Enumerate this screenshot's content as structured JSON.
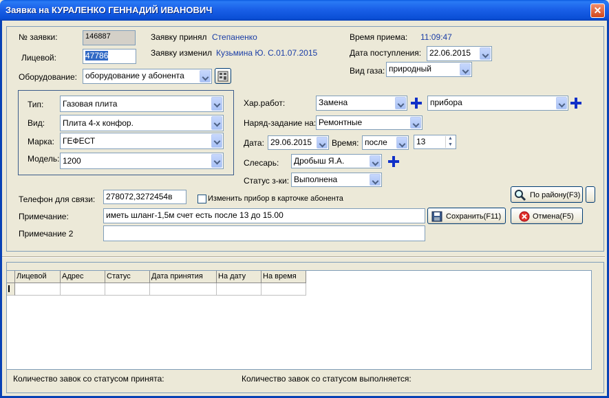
{
  "window": {
    "title": "Заявка на КУРАЛЕНКО ГЕННАДИЙ ИВАНОВИЧ",
    "close_icon": "close-icon"
  },
  "header": {
    "order_no_label": "№ заявки:",
    "order_no_value": "146887",
    "account_label": "Лицевой:",
    "account_value": "47786",
    "equipment_label": "Оборудование:",
    "equipment_value": "оборудование у абонента",
    "accepted_by_label": "Заявку принял",
    "accepted_by_value": "Степаненко",
    "changed_by_label": "Заявку изменил",
    "changed_by_value": "Кузьмина Ю. С.01.07.2015",
    "reception_time_label": "Время приема:",
    "reception_time_value": "11:09:47",
    "arrival_date_label": "Дата поступления:",
    "arrival_date_value": "22.06.2015",
    "gas_type_label": "Вид газа:",
    "gas_type_value": "природный"
  },
  "device": {
    "type_label": "Тип:",
    "type_value": "Газовая плита",
    "kind_label": "Вид:",
    "kind_value": "Плита 4-х конфор.",
    "brand_label": "Марка:",
    "brand_value": "ГЕФЕСТ",
    "model_label": "Модель:",
    "model_value": "1200"
  },
  "work": {
    "work_char_label": "Хар.работ:",
    "work_char_value": "Замена",
    "work_object_value": "прибора",
    "task_label": "Наряд-задание на:",
    "task_value": "Ремонтные",
    "date_label": "Дата:",
    "date_value": "29.06.2015",
    "time_label": "Время:",
    "time_value": "после",
    "time_hour": "13",
    "fitter_label": "Слесарь:",
    "fitter_value": "Дробыш Я.А.",
    "status_label": "Статус з-ки:",
    "status_value": "Выполнена"
  },
  "contact": {
    "phone_label": "Телефон для связи:",
    "phone_value": "278072,3272454в",
    "change_device_label": "Изменить прибор в карточке абонента",
    "note_label": "Примечание:",
    "note_value": "иметь шланг-1,5м  счет есть после 13 до 15.00",
    "note2_label": "Примечание 2",
    "note2_value": ""
  },
  "buttons": {
    "by_district": "По району(F3)",
    "save": "Сохранить(F11)",
    "cancel": "Отмена(F5)"
  },
  "grid": {
    "columns": [
      "Лицевой",
      "Адрес",
      "Статус",
      "Дата принятия",
      "На дату",
      "На время"
    ]
  },
  "footer": {
    "count_accepted_label": "Количество завок со статусом принята:",
    "count_in_progress_label": "Количество завок со статусом выполняется:"
  }
}
